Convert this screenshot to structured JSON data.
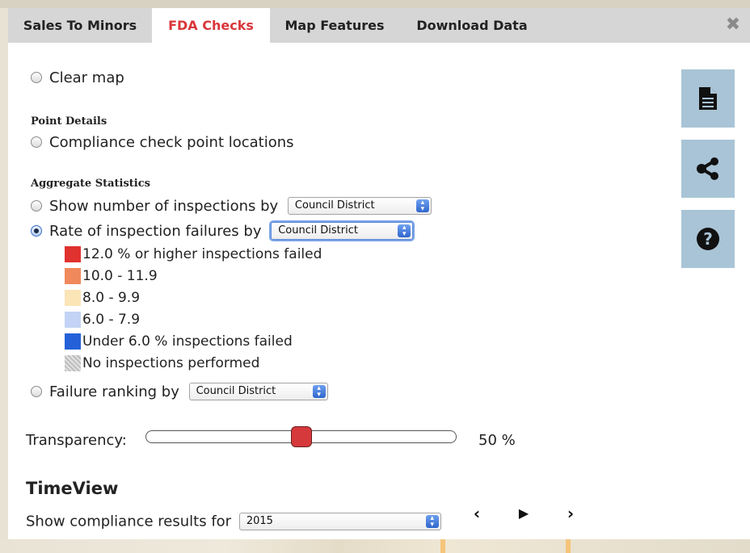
{
  "tabs": [
    {
      "label": "Sales To Minors"
    },
    {
      "label": "FDA Checks"
    },
    {
      "label": "Map Features"
    },
    {
      "label": "Download Data"
    }
  ],
  "close_icon": "close-icon",
  "options": {
    "clear_map": "Clear map",
    "point_details_heading": "Point Details",
    "point_locations": "Compliance check point locations",
    "aggregate_heading": "Aggregate Statistics",
    "show_number": "Show number of inspections by",
    "rate_failures": "Rate of inspection failures by",
    "failure_ranking": "Failure ranking by",
    "selected_option": "Rate of inspection failures by"
  },
  "selects": {
    "show_number": "Council District",
    "rate_failures": "Council District",
    "failure_ranking": "Council District"
  },
  "legend": [
    {
      "label": "12.0 % or higher inspections failed",
      "color": "#e0322f"
    },
    {
      "label": "10.0 - 11.9",
      "color": "#f0895c"
    },
    {
      "label": "8.0 - 9.9",
      "color": "#fbe4b6"
    },
    {
      "label": "6.0 - 7.9",
      "color": "#c3d3f5"
    },
    {
      "label": "Under 6.0 % inspections failed",
      "color": "#2461d8"
    },
    {
      "label": "No inspections performed",
      "color": "#c9c9c9"
    }
  ],
  "transparency": {
    "label": "Transparency:",
    "value_text": "50 %",
    "value": 0.5
  },
  "timeview": {
    "heading": "TimeView",
    "label": "Show compliance results for",
    "year": "2015"
  },
  "side_buttons": [
    "document-icon",
    "share-icon",
    "help-icon"
  ],
  "colors": {
    "active_tab": "#d9373b",
    "tab_bar": "#d6d6d6",
    "side_button": "#a9c4d6",
    "slider_thumb": "#d6393b"
  }
}
